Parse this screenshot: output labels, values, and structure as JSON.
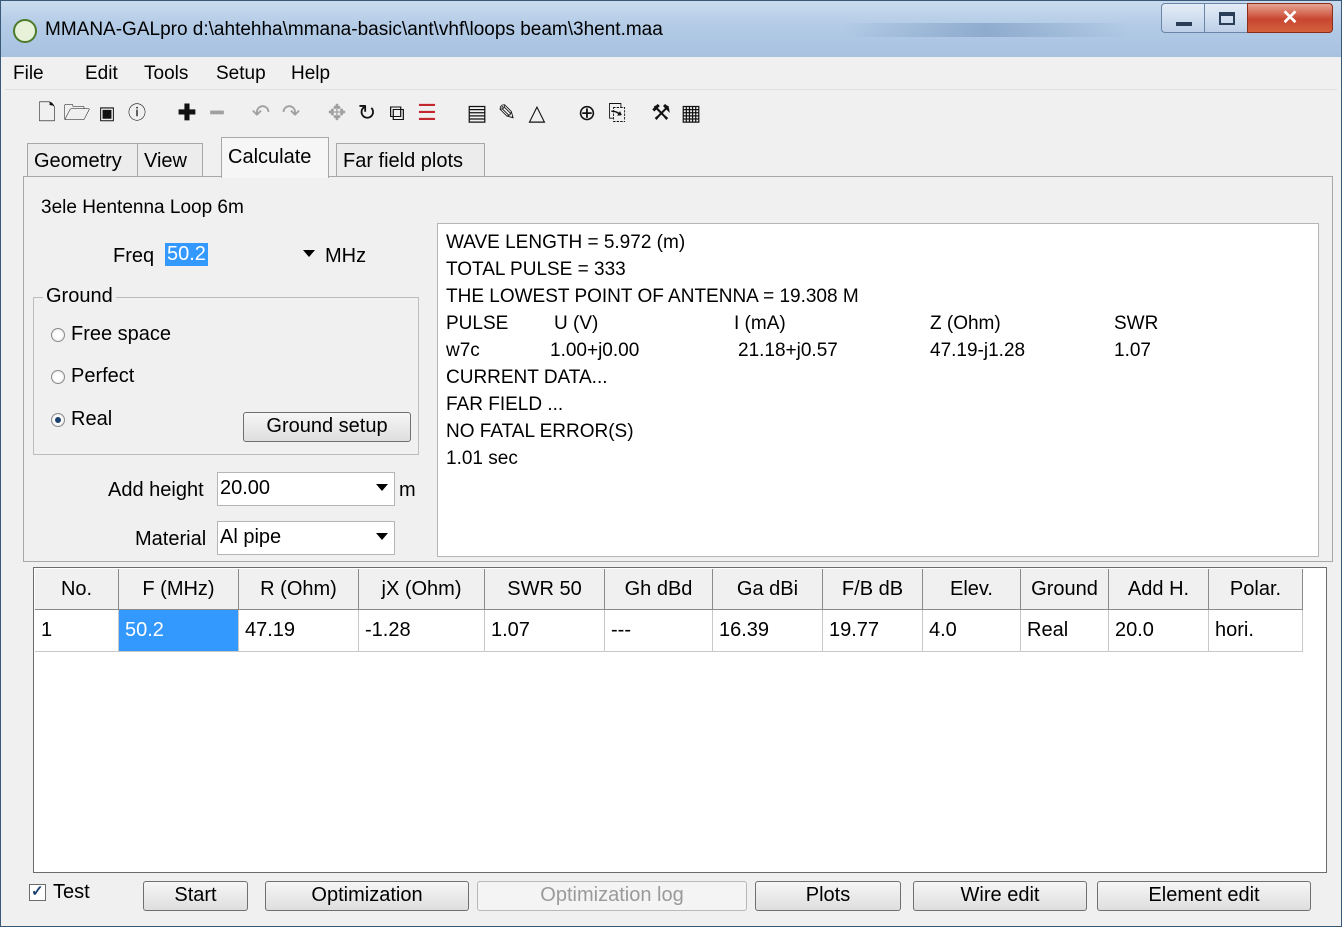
{
  "window": {
    "title": "MMANA-GALpro d:\\ahtehha\\mmana-basic\\ant\\vhf\\loops beam\\3hent.maa"
  },
  "menu": [
    "File",
    "Edit",
    "Tools",
    "Setup",
    "Help"
  ],
  "toolbar_icons": [
    "new-file-icon",
    "open-folder-icon",
    "save-icon",
    "info-icon",
    "add-icon",
    "remove-icon",
    "undo-icon",
    "redo-icon",
    "move-icon",
    "rotate-icon",
    "copy-stretch-icon",
    "list-icon",
    "document-icon",
    "edit-icon",
    "triangle-icon",
    "target-icon",
    "copy-icon",
    "tools-icon",
    "calculator-icon"
  ],
  "tabs": [
    "Geometry",
    "View",
    "Calculate",
    "Far field plots"
  ],
  "antenna_name": "3ele Hentenna Loop 6m",
  "freq": {
    "label": "Freq",
    "value": "50.2",
    "unit": "MHz"
  },
  "ground": {
    "legend": "Ground",
    "options": [
      "Free space",
      "Perfect",
      "Real"
    ],
    "selected": "Real",
    "setup_label": "Ground setup"
  },
  "add_height": {
    "label": "Add height",
    "value": "20.00",
    "unit": "m"
  },
  "material": {
    "label": "Material",
    "value": "Al pipe"
  },
  "output": {
    "line1": "WAVE LENGTH = 5.972 (m)",
    "line2": "TOTAL PULSE = 333",
    "line3": "THE LOWEST POINT OF ANTENNA = 19.308 M",
    "table_header": [
      "PULSE",
      "U (V)",
      "I (mA)",
      "Z (Ohm)",
      "SWR"
    ],
    "table_row": [
      "w7c",
      "1.00+j0.00",
      "21.18+j0.57",
      "47.19-j1.28",
      "1.07"
    ],
    "line4": "CURRENT DATA...",
    "line5": "FAR FIELD ...",
    "line6": "NO FATAL ERROR(S)",
    "line7": "1.01 sec"
  },
  "results": {
    "headers": [
      "No.",
      "F (MHz)",
      "R (Ohm)",
      "jX (Ohm)",
      "SWR 50",
      "Gh dBd",
      "Ga dBi",
      "F/B dB",
      "Elev.",
      "Ground",
      "Add H.",
      "Polar."
    ],
    "rows": [
      [
        "1",
        "50.2",
        "47.19",
        "-1.28",
        "1.07",
        "---",
        "16.39",
        "19.77",
        "4.0",
        "Real",
        "20.0",
        "hori."
      ]
    ]
  },
  "bottom": {
    "test_label": "Test",
    "test_checked": true,
    "buttons": [
      "Start",
      "Optimization",
      "Optimization log",
      "Plots",
      "Wire edit",
      "Element edit"
    ]
  }
}
